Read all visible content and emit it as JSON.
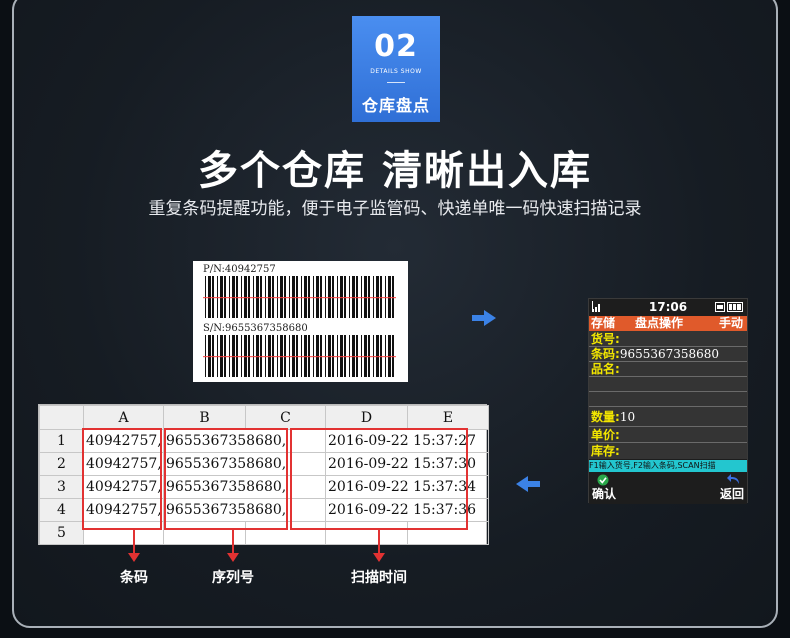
{
  "badge": {
    "number": "02",
    "subtitle": "DETAILS SHOW",
    "label": "仓库盘点"
  },
  "headline": "多个仓库 清晰出入库",
  "subheadline": "重复条码提醒功能，便于电子监管码、快递单唯一码快速扫描记录",
  "barcode_label": {
    "pn": "P/N:40942757",
    "sn": "S/N:9655367358680"
  },
  "colors": {
    "accent_blue": "#3b82e6",
    "highlight_red": "#e23232",
    "device_header": "#e05a2b",
    "device_tip": "#23c6cf",
    "device_label_yellow": "#f2e600"
  },
  "sheet": {
    "columns": [
      "A",
      "B",
      "C",
      "D",
      "E"
    ],
    "row_numbers": [
      "1",
      "2",
      "3",
      "4",
      "5"
    ],
    "rows": [
      {
        "a": "40942757,",
        "b": "9655367358680,",
        "d": "2016-09-22 15:37:27"
      },
      {
        "a": "40942757,",
        "b": "9655367358680,",
        "d": "2016-09-22 15:37:30"
      },
      {
        "a": "40942757,",
        "b": "9655367358680,",
        "d": "2016-09-22 15:37:34"
      },
      {
        "a": "40942757,",
        "b": "9655367358680,",
        "d": "2016-09-22 15:37:36"
      }
    ]
  },
  "captions": {
    "barcode": "条码",
    "serial": "序列号",
    "scan_time": "扫描时间"
  },
  "device": {
    "time": "17:06",
    "header_left": "存储",
    "header_mid": "盘点操作",
    "header_right": "手动",
    "huohao_label": "货号:",
    "tiaoma_label": "条码:",
    "tiaoma_value": "9655367358680",
    "pinming_label": "品名:",
    "shuliang_label": "数量:",
    "shuliang_value": "10",
    "danjia_label": "单价:",
    "kucun_label": "库存:",
    "tip": "F1输入货号,F2输入条码,SCAN扫描",
    "confirm": "确认",
    "back": "返回"
  },
  "icons": [
    "right-arrow-icon",
    "left-arrow-icon",
    "signal-icon",
    "battery-icon",
    "sim-icon",
    "check-icon",
    "return-icon"
  ]
}
